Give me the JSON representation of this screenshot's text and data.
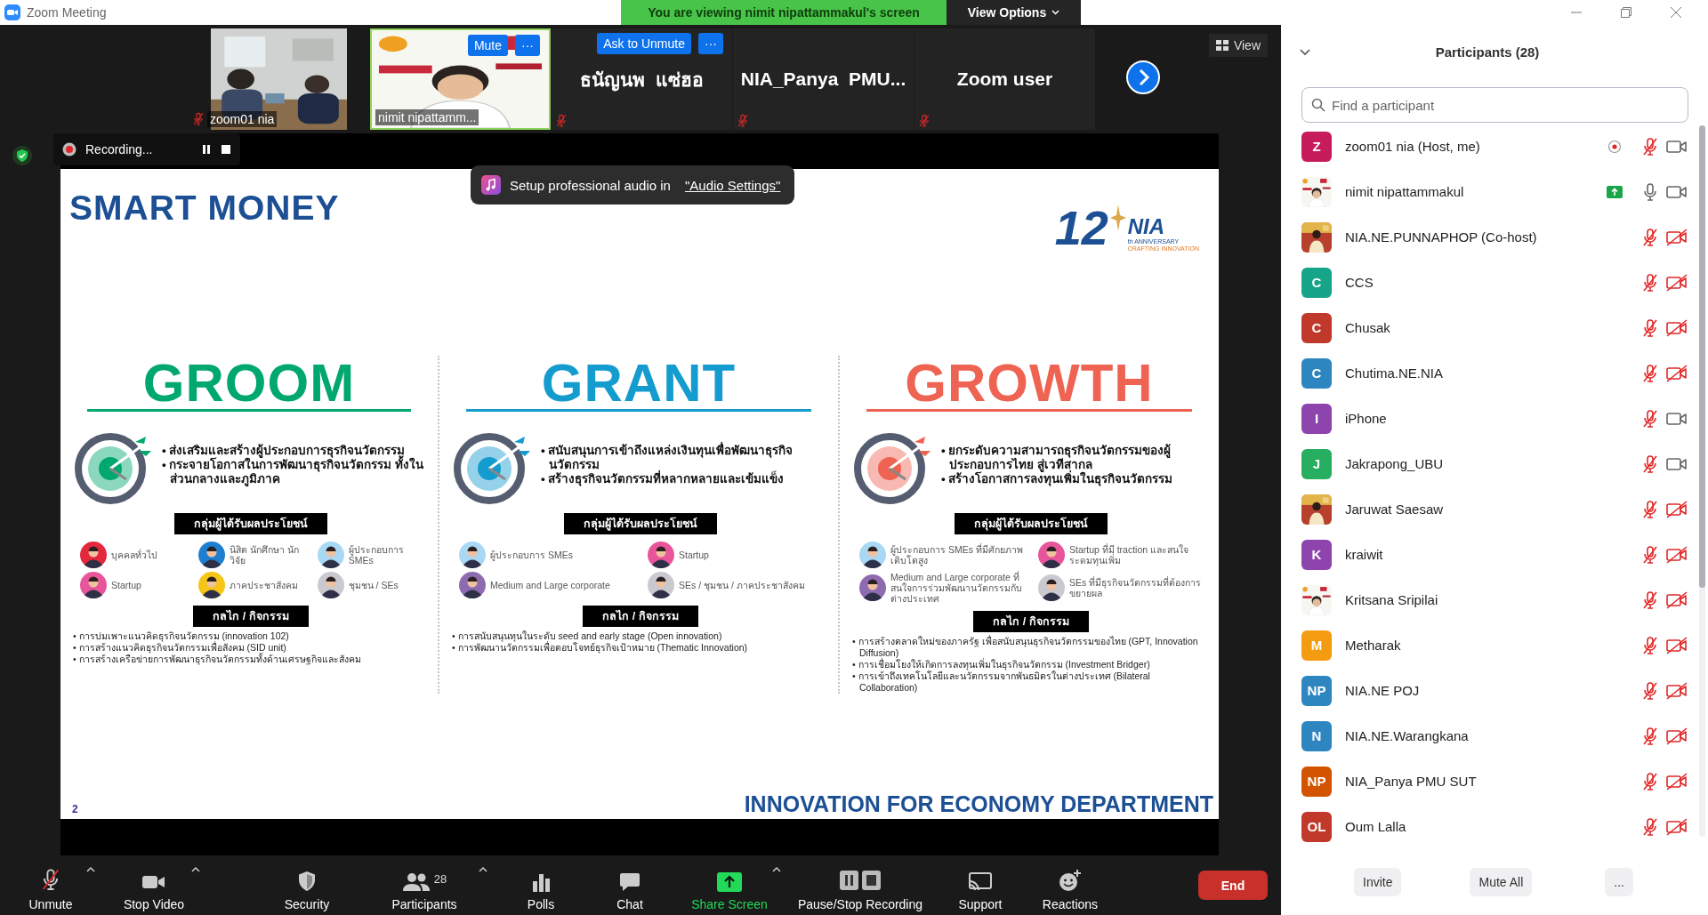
{
  "window": {
    "title": "Zoom Meeting"
  },
  "banner": {
    "message": "You are viewing nimit nipattammakul's screen",
    "options_label": "View Options"
  },
  "thumbnails": [
    {
      "kind": "video",
      "name": "zoom01 nia",
      "muted": true,
      "speaking": false
    },
    {
      "kind": "video",
      "name": "nimit nipattamm...",
      "muted": false,
      "speaking": true,
      "actions": [
        "Mute",
        "···"
      ]
    },
    {
      "kind": "name",
      "name": "ธนัญนพ  แซ่ฮอ",
      "muted": true,
      "speaking": false,
      "actions": [
        "Ask to Unmute",
        "···"
      ]
    },
    {
      "kind": "name",
      "name": "NIA_Panya  PMU...",
      "muted": true,
      "speaking": false
    },
    {
      "kind": "name",
      "name": "Zoom user",
      "muted": true,
      "speaking": false
    }
  ],
  "view_button": "View",
  "recording": {
    "label": "Recording..."
  },
  "audio_tip": {
    "text": "Setup professional audio in",
    "link": "\"Audio Settings\""
  },
  "slide": {
    "title": "SMART MONEY",
    "logo": {
      "number": "12",
      "suffix": "th",
      "caption": "ANNIVERSARY",
      "name": "NIA",
      "tagline": "CRAFTING INNOVATION"
    },
    "columns": [
      {
        "heading": "GROOM",
        "color": "#00a870",
        "goals": [
          "• ส่งเสริมและสร้างผู้ประกอบการธุรกิจนวัตกรรม",
          "• กระจายโอกาสในการพัฒนาธุรกิจนวัตกรรม ทั้งในส่วนกลางและภูมิภาค"
        ],
        "beneficiaries_label": "กลุ่มผู้ได้รับผลประโยชน์",
        "beneficiaries": [
          {
            "label": "บุคคลทั่วไป",
            "color": "#e5283c"
          },
          {
            "label": "นิสิต นักศึกษา นักวิจัย",
            "color": "#1e7fd0"
          },
          {
            "label": "ผู้ประกอบการ SMEs",
            "color": "#a9d8f5"
          },
          {
            "label": "Startup",
            "color": "#e8559a"
          },
          {
            "label": "ภาคประชาสังคม",
            "color": "#f5c518"
          },
          {
            "label": "ชุมชน / SEs",
            "color": "#c9c9cf"
          }
        ],
        "mechanisms_label": "กลไก / กิจกรรม",
        "mechanisms": [
          "• การบ่มเพาะแนวคิดธุรกิจนวัตกรรม (innovation 102)",
          "• การสร้างแนวคิดธุรกิจนวัตกรรมเพื่อสังคม (SID unit)",
          "• การสร้างเครือข่ายการพัฒนาธุรกิจนวัตกรรมทั้งด้านเศรษฐกิจและสังคม"
        ]
      },
      {
        "heading": "GRANT",
        "color": "#149ccf",
        "goals": [
          "• สนับสนุนการเข้าถึงแหล่งเงินทุนเพื่อพัฒนาธุรกิจนวัตกรรม",
          "• สร้างธุรกิจนวัตกรรมที่หลากหลายและเข้มแข็ง"
        ],
        "beneficiaries_label": "กลุ่มผู้ได้รับผลประโยชน์",
        "beneficiaries": [
          {
            "label": "ผู้ประกอบการ SMEs",
            "color": "#a9d8f5"
          },
          {
            "label": "Startup",
            "color": "#e8559a"
          },
          {
            "label": "Medium and Large corporate",
            "color": "#8e6bb0"
          },
          {
            "label": "SEs / ชุมชน / ภาคประชาสังคม",
            "color": "#c9c9cf"
          }
        ],
        "mechanisms_label": "กลไก / กิจกรรม",
        "mechanisms": [
          "• การสนับสนุนทุนในระดับ seed and early stage (Open innovation)",
          "• การพัฒนานวัตกรรมเพื่อตอบโจทย์ธุรกิจเป้าหมาย (Thematic Innovation)"
        ]
      },
      {
        "heading": "GROWTH",
        "color": "#ee6352",
        "goals": [
          "• ยกระดับความสามารถธุรกิจนวัตกรรมของผู้ประกอบการไทย สู่เวทีสากล",
          "• สร้างโอกาสการลงทุนเพิ่มในธุรกิจนวัตกรรม"
        ],
        "beneficiaries_label": "กลุ่มผู้ได้รับผลประโยชน์",
        "beneficiaries": [
          {
            "label": "ผู้ประกอบการ SMEs ที่มีศักยภาพเติบโตสูง",
            "color": "#a9d8f5"
          },
          {
            "label": "Startup ที่มี traction และสนใจระดมทุนเพิ่ม",
            "color": "#e8559a"
          },
          {
            "label": "Medium and Large corporate ที่สนใจการร่วมพัฒนานวัตกรรมกับต่างประเทศ",
            "color": "#8e6bb0"
          },
          {
            "label": "SEs ที่มีธุรกิจนวัตกรรมที่ต้องการขยายผล",
            "color": "#c9c9cf"
          }
        ],
        "mechanisms_label": "กลไก / กิจกรรม",
        "mechanisms": [
          "• การสร้างตลาดใหม่ของภาครัฐ เพื่อสนับสนุนธุรกิจนวัตกรรมของไทย (GPT, Innovation Diffusion)",
          "• การเชื่อมโยงให้เกิดการลงทุนเพิ่มในธุรกิจนวัตกรรม (Investment Bridger)",
          "• การเข้าถึงเทคโนโลยีและนวัตกรรมจากพันธมิตรในต่างประเทศ (Bilateral Collaboration)"
        ]
      }
    ],
    "page": "2",
    "footer": "INNOVATION FOR ECONOMY DEPARTMENT"
  },
  "toolbar": {
    "items": [
      {
        "kind": "mic",
        "label": "Unmute",
        "muted": true,
        "menu": true,
        "highlighted": false
      },
      {
        "kind": "video",
        "label": "Stop Video",
        "menu": true,
        "highlighted": false
      },
      {
        "kind": "security",
        "label": "Security",
        "menu": false,
        "highlighted": false
      },
      {
        "kind": "participants",
        "label": "Participants",
        "count": "28",
        "menu": true,
        "highlighted": false
      },
      {
        "kind": "polls",
        "label": "Polls",
        "menu": false,
        "highlighted": false
      },
      {
        "kind": "chat",
        "label": "Chat",
        "menu": false,
        "highlighted": false
      },
      {
        "kind": "share",
        "label": "Share Screen",
        "menu": true,
        "highlighted": true
      },
      {
        "kind": "recording",
        "label": "Pause/Stop Recording",
        "menu": false,
        "highlighted": false
      },
      {
        "kind": "support",
        "label": "Support",
        "menu": false,
        "highlighted": false
      },
      {
        "kind": "reactions",
        "label": "Reactions",
        "menu": false,
        "highlighted": false
      }
    ],
    "end_label": "End"
  },
  "panel": {
    "title": "Participants (28)",
    "search": {
      "placeholder": "Find a participant"
    },
    "participants": [
      {
        "name": "zoom01 nia (Host, me)",
        "avatar": {
          "kind": "initials",
          "text": "Z",
          "color": "#c71c5c"
        },
        "muted": true,
        "video": true,
        "recording": true
      },
      {
        "name": "nimit nipattammakul",
        "muted": false,
        "video": true,
        "sharing": true
      },
      {
        "name": "NIA.NE.PUNNAPHOP (Co-host)",
        "muted": true,
        "video": false
      },
      {
        "name": "CCS",
        "avatar": {
          "kind": "initials",
          "text": "C",
          "color": "#17a589"
        },
        "muted": true,
        "video": false
      },
      {
        "name": "Chusak",
        "avatar": {
          "kind": "initials",
          "text": "C",
          "color": "#c0392b"
        },
        "muted": true,
        "video": false
      },
      {
        "name": "Chutima.NE.NIA",
        "avatar": {
          "kind": "initials",
          "text": "C",
          "color": "#2e86c1"
        },
        "muted": true,
        "video": false
      },
      {
        "name": "iPhone",
        "avatar": {
          "kind": "initials",
          "text": "I",
          "color": "#8e44ad"
        },
        "muted": true,
        "video": true
      },
      {
        "name": "Jakrapong_UBU",
        "avatar": {
          "kind": "initials",
          "text": "J",
          "color": "#27ae60"
        },
        "muted": true,
        "video": true
      },
      {
        "name": "Jaruwat Saesaw",
        "muted": true,
        "video": false
      },
      {
        "name": "kraiwit",
        "avatar": {
          "kind": "initials",
          "text": "K",
          "color": "#8e44ad"
        },
        "muted": true,
        "video": false
      },
      {
        "name": "Kritsana Sripilai",
        "muted": true,
        "video": false
      },
      {
        "name": "Metharak",
        "avatar": {
          "kind": "initials",
          "text": "M",
          "color": "#f39c12"
        },
        "muted": true,
        "video": false
      },
      {
        "name": "NIA.NE POJ",
        "avatar": {
          "kind": "initials",
          "text": "NP",
          "color": "#2e86c1"
        },
        "muted": true,
        "video": false
      },
      {
        "name": "NIA.NE.Warangkana",
        "avatar": {
          "kind": "initials",
          "text": "N",
          "color": "#2e86c1"
        },
        "muted": true,
        "video": false
      },
      {
        "name": "NIA_Panya PMU SUT",
        "avatar": {
          "kind": "initials",
          "text": "NP",
          "color": "#d35400"
        },
        "muted": true,
        "video": false
      },
      {
        "name": "Oum Lalla",
        "avatar": {
          "kind": "initials",
          "text": "OL",
          "color": "#c0392b"
        },
        "muted": true,
        "video": false
      }
    ],
    "buttons": [
      "Invite",
      "Mute All",
      "..."
    ]
  }
}
